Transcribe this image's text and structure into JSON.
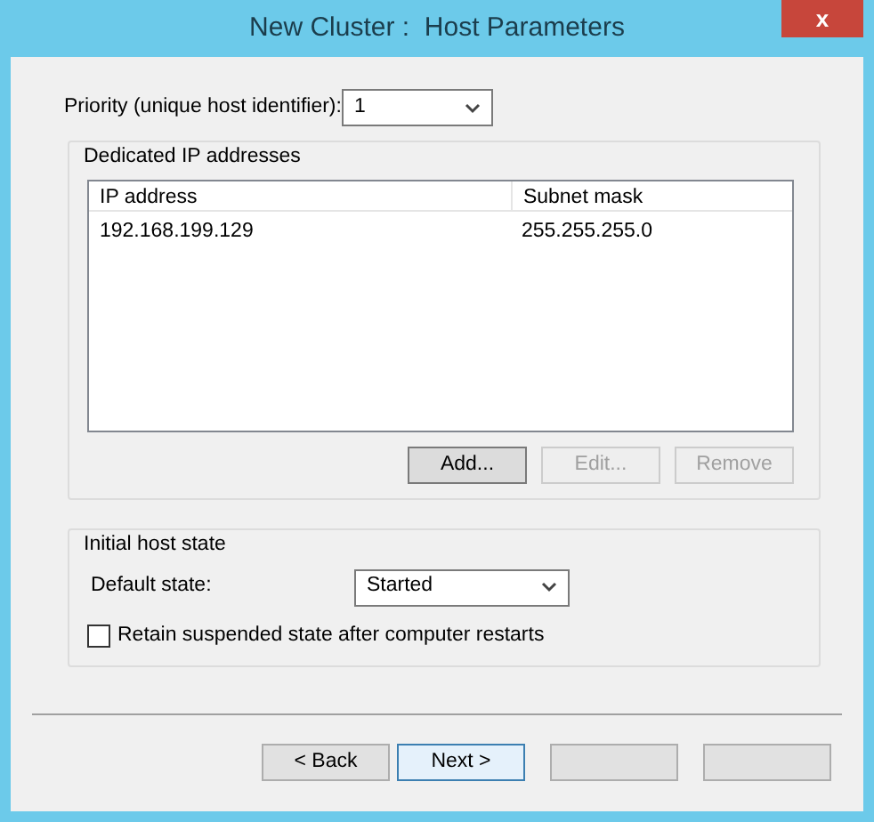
{
  "window": {
    "title": "New Cluster :  Host Parameters",
    "close": "x"
  },
  "priority": {
    "label": "Priority (unique host identifier):",
    "value": "1"
  },
  "dedicated_ip": {
    "title": "Dedicated IP addresses",
    "columns": [
      "IP address",
      "Subnet mask"
    ],
    "rows": [
      [
        "192.168.199.129",
        "255.255.255.0"
      ]
    ],
    "buttons": [
      {
        "label": "Add...",
        "disabled": false,
        "focused": true
      },
      {
        "label": "Edit...",
        "disabled": true,
        "focused": false
      },
      {
        "label": "Remove",
        "disabled": true,
        "focused": false
      }
    ]
  },
  "initial_state": {
    "title": "Initial host state",
    "default_label": "Default state:",
    "default_value": "Started",
    "retain": {
      "label": "Retain suspended state after computer restarts",
      "checked": false
    }
  },
  "footer_buttons": [
    {
      "label": "< Back",
      "default": false
    },
    {
      "label": "Next >",
      "default": true
    },
    {
      "default": false
    },
    {
      "default": false
    }
  ]
}
